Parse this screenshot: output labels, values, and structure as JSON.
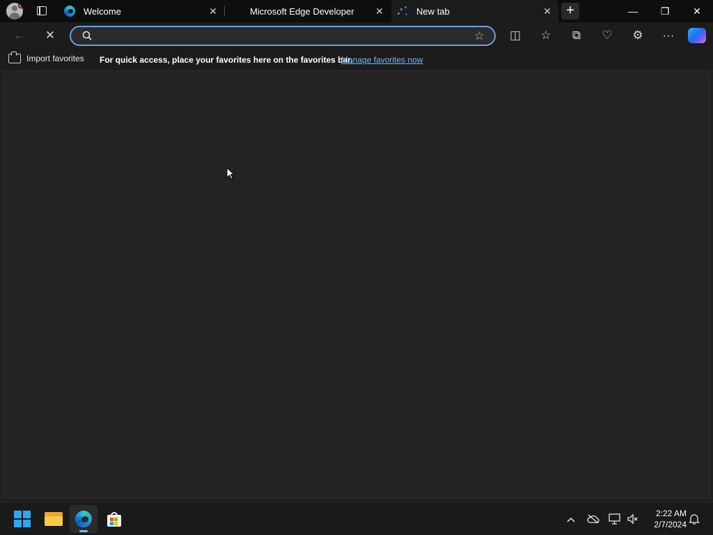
{
  "browser": {
    "tabs": [
      {
        "title": "Welcome",
        "close": "✕"
      },
      {
        "title": "Microsoft Edge Developer",
        "close": "✕"
      },
      {
        "title": "New tab",
        "close": "✕"
      }
    ],
    "new_tab_glyph": "+",
    "window_controls": {
      "minimize": "—",
      "restore": "❐",
      "close": "✕"
    }
  },
  "toolbar": {
    "back_glyph": "←",
    "stop_glyph": "✕",
    "address_value": "",
    "favorite_star_glyph": "☆",
    "split_screen_glyph": "◫",
    "favorites_glyph": "☆",
    "collections_glyph": "⧉",
    "browser_essentials_glyph": "♡",
    "extensions_glyph": "⚙",
    "more_glyph": "···"
  },
  "favorites_bar": {
    "import_label": "Import favorites",
    "message": "For quick access, place your favorites here on the favorites bar.",
    "manage_link": "Manage favorites now"
  },
  "taskbar": {
    "tray": {
      "chevron": "^",
      "clock_time": "2:22 AM",
      "clock_date": "2/7/2024"
    }
  },
  "colors": {
    "accent": "#6aa3d8",
    "link": "#72b8f5",
    "windows_blue": "#30a6f0"
  },
  "icons": [
    "profile-icon",
    "tab-actions-icon",
    "edge-icon",
    "loading-icon",
    "search-icon",
    "star-icon",
    "copilot-icon",
    "folder-icon",
    "store-icon",
    "network-icon",
    "volume-icon",
    "notification-icon"
  ]
}
